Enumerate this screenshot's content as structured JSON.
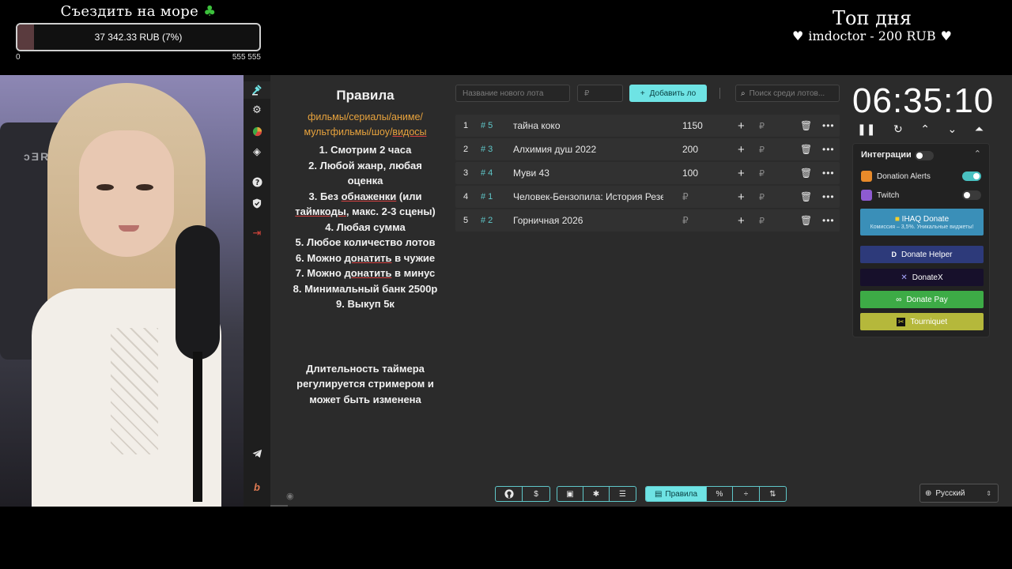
{
  "goal": {
    "title": "Съездить на море",
    "amount_label": "37 342.33 RUB (7%)",
    "progress": 0.07,
    "min": "0",
    "max": "555 555"
  },
  "top_day": {
    "title": "Топ дня",
    "line": "imdoctor - 200 RUB"
  },
  "rules": {
    "title": "Правила",
    "genres_line1": "фильмы/сериалы/аниме/",
    "genres_line2_a": "мультфильмы/шоу/",
    "genres_line2_b": "видосы",
    "r1": "1. Смотрим 2 часа",
    "r2a": "2. Любой жанр, любая",
    "r2b": "оценка",
    "r3a_pre": "3. Без ",
    "r3a_u": "обнаженки",
    "r3a_post": " (или",
    "r3b_u": "таймкоды",
    "r3b_post": ", макс. 2-3 сцены)",
    "r4": "4. Любая сумма",
    "r5": "5. Любое количество лотов",
    "r6_pre": "6. Можно ",
    "r6_u": "донатить",
    "r6_post": " в чужие",
    "r7_pre": "7. Можно ",
    "r7_u": "донатить",
    "r7_post": " в минус",
    "r8": "8. Минимальный банк 2500р",
    "r9": "9. Выкуп 5к",
    "note1": "Длительность таймера",
    "note2": "регулируется стримером и",
    "note3": "может быть изменена"
  },
  "controls": {
    "lot_name_placeholder": "Название нового лота",
    "amount_placeholder": "₽",
    "add_label": "Добавить ло",
    "search_placeholder": "Поиск среди лотов..."
  },
  "lots": [
    {
      "idx": "1",
      "id": "# 5",
      "name": "тайна коко",
      "amount": "1150"
    },
    {
      "idx": "2",
      "id": "# 3",
      "name": "Алхимия душ 2022",
      "amount": "200"
    },
    {
      "idx": "3",
      "id": "# 4",
      "name": "Муви 43",
      "amount": "100"
    },
    {
      "idx": "4",
      "id": "# 1",
      "name": "Человек-Бензопила: История Резе",
      "amount": "₽"
    },
    {
      "idx": "5",
      "id": "# 2",
      "name": "Горничная 2026",
      "amount": "₽"
    }
  ],
  "lot_currency": "₽",
  "timer": {
    "value": "06:35:10"
  },
  "integrations": {
    "title": "Интеграции",
    "donation_alerts": "Donation Alerts",
    "twitch": "Twitch",
    "ihaq": "IHAQ Donate",
    "ihaq_sub": "Комиссия – 3,5%. Уникальные виджеты!",
    "donate_helper": "Donate Helper",
    "donatex": "DonateX",
    "donate_pay": "Donate Pay",
    "tourniquet": "Tourniquet",
    "colors": {
      "ihaq": "#3a8fb8",
      "donate_helper": "#2d3a7a",
      "donatex": "#17102b",
      "donate_pay": "#3dab46",
      "tourniquet": "#b5b83b"
    }
  },
  "bottom": {
    "rules_tab": "Правила",
    "language": "Русский"
  },
  "accent": "#6ee3e4"
}
